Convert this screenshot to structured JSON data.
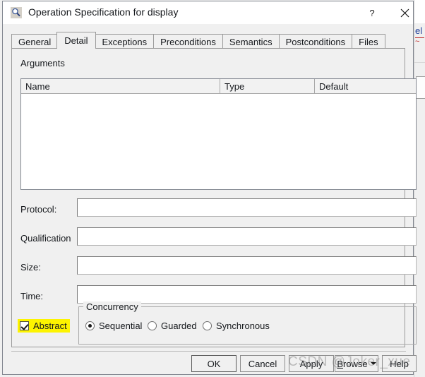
{
  "window": {
    "title": "Operation Specification for display",
    "icon": "magnifier-icon",
    "help_label": "?",
    "close_label": "✕"
  },
  "tabs": [
    {
      "label": "General",
      "active": false
    },
    {
      "label": "Detail",
      "active": true
    },
    {
      "label": "Exceptions",
      "active": false
    },
    {
      "label": "Preconditions",
      "active": false
    },
    {
      "label": "Semantics",
      "active": false
    },
    {
      "label": "Postconditions",
      "active": false
    },
    {
      "label": "Files",
      "active": false
    }
  ],
  "arguments": {
    "group_label": "Arguments",
    "columns": [
      "Name",
      "Type",
      "Default"
    ],
    "rows": []
  },
  "fields": [
    {
      "label": "Protocol:",
      "value": "",
      "placeholder": ""
    },
    {
      "label": "Qualification",
      "value": "",
      "placeholder": ""
    },
    {
      "label": "Size:",
      "value": "",
      "placeholder": ""
    },
    {
      "label": "Time:",
      "value": "",
      "placeholder": ""
    }
  ],
  "abstract": {
    "label": "Abstract",
    "checked": true,
    "highlight_color": "#fdf400"
  },
  "concurrency": {
    "title": "Concurrency",
    "options": [
      {
        "label": "Sequential",
        "selected": true
      },
      {
        "label": "Guarded",
        "selected": false
      },
      {
        "label": "Synchronous",
        "selected": false
      }
    ]
  },
  "buttons": {
    "ok": "OK",
    "cancel": "Cancel",
    "apply": "Apply",
    "browse_accel": "B",
    "browse_rest": "rowse",
    "help": "Help"
  },
  "watermark": {
    "text": "CSDN @Joker_xue"
  },
  "background_window": {
    "partial_text": "el"
  }
}
